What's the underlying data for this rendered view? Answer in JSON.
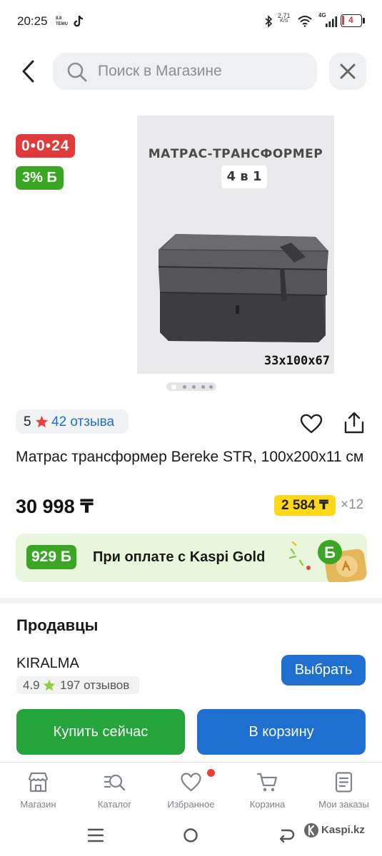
{
  "status_bar": {
    "time": "20:25",
    "net_speed_value": "2,71",
    "net_speed_unit": "K/S",
    "network": "4G",
    "battery": "4"
  },
  "search": {
    "placeholder": "Поиск в Магазине"
  },
  "badges": {
    "timer": "0•0•24",
    "bonus": "3% Б"
  },
  "product_image": {
    "headline": "МАТРАС-ТРАНСФОРМЕР",
    "four_in_one": "4 в 1",
    "dimensions": "33x100x67",
    "slides_total": 5,
    "slide_active": 1
  },
  "rating": {
    "score": "5",
    "reviews_label": "42 отзыва"
  },
  "product": {
    "title": "Матрас трансформер Bereke STR, 100х200х11 см",
    "price": "30 998 ₸",
    "installment": "2 584 ₸",
    "installment_months": "×12"
  },
  "kaspi_gold": {
    "bonus": "929 Б",
    "text": "При оплате с Kaspi Gold"
  },
  "sellers": {
    "heading": "Продавцы",
    "seller_name": "KIRALMA",
    "seller_rating": "4.9",
    "seller_reviews": "197 отзывов",
    "choose_label": "Выбрать"
  },
  "actions": {
    "buy_now": "Купить сейчас",
    "add_to_cart": "В корзину"
  },
  "bottom_nav": [
    {
      "label": "Магазин",
      "icon": "store-icon"
    },
    {
      "label": "Каталог",
      "icon": "catalog-icon"
    },
    {
      "label": "Избранное",
      "icon": "heart-icon"
    },
    {
      "label": "Корзина",
      "icon": "cart-icon"
    },
    {
      "label": "Мои заказы",
      "icon": "orders-icon"
    }
  ],
  "watermark": "Kaspi.kz",
  "colors": {
    "timer_red": "#e23a3a",
    "bonus_green": "#3aa624",
    "link_blue": "#1f6fcb",
    "primary_blue": "#1e6fd0",
    "buy_green": "#25a43c",
    "installment_yellow": "#ffd81a",
    "notification_dot": "#e8423a"
  }
}
